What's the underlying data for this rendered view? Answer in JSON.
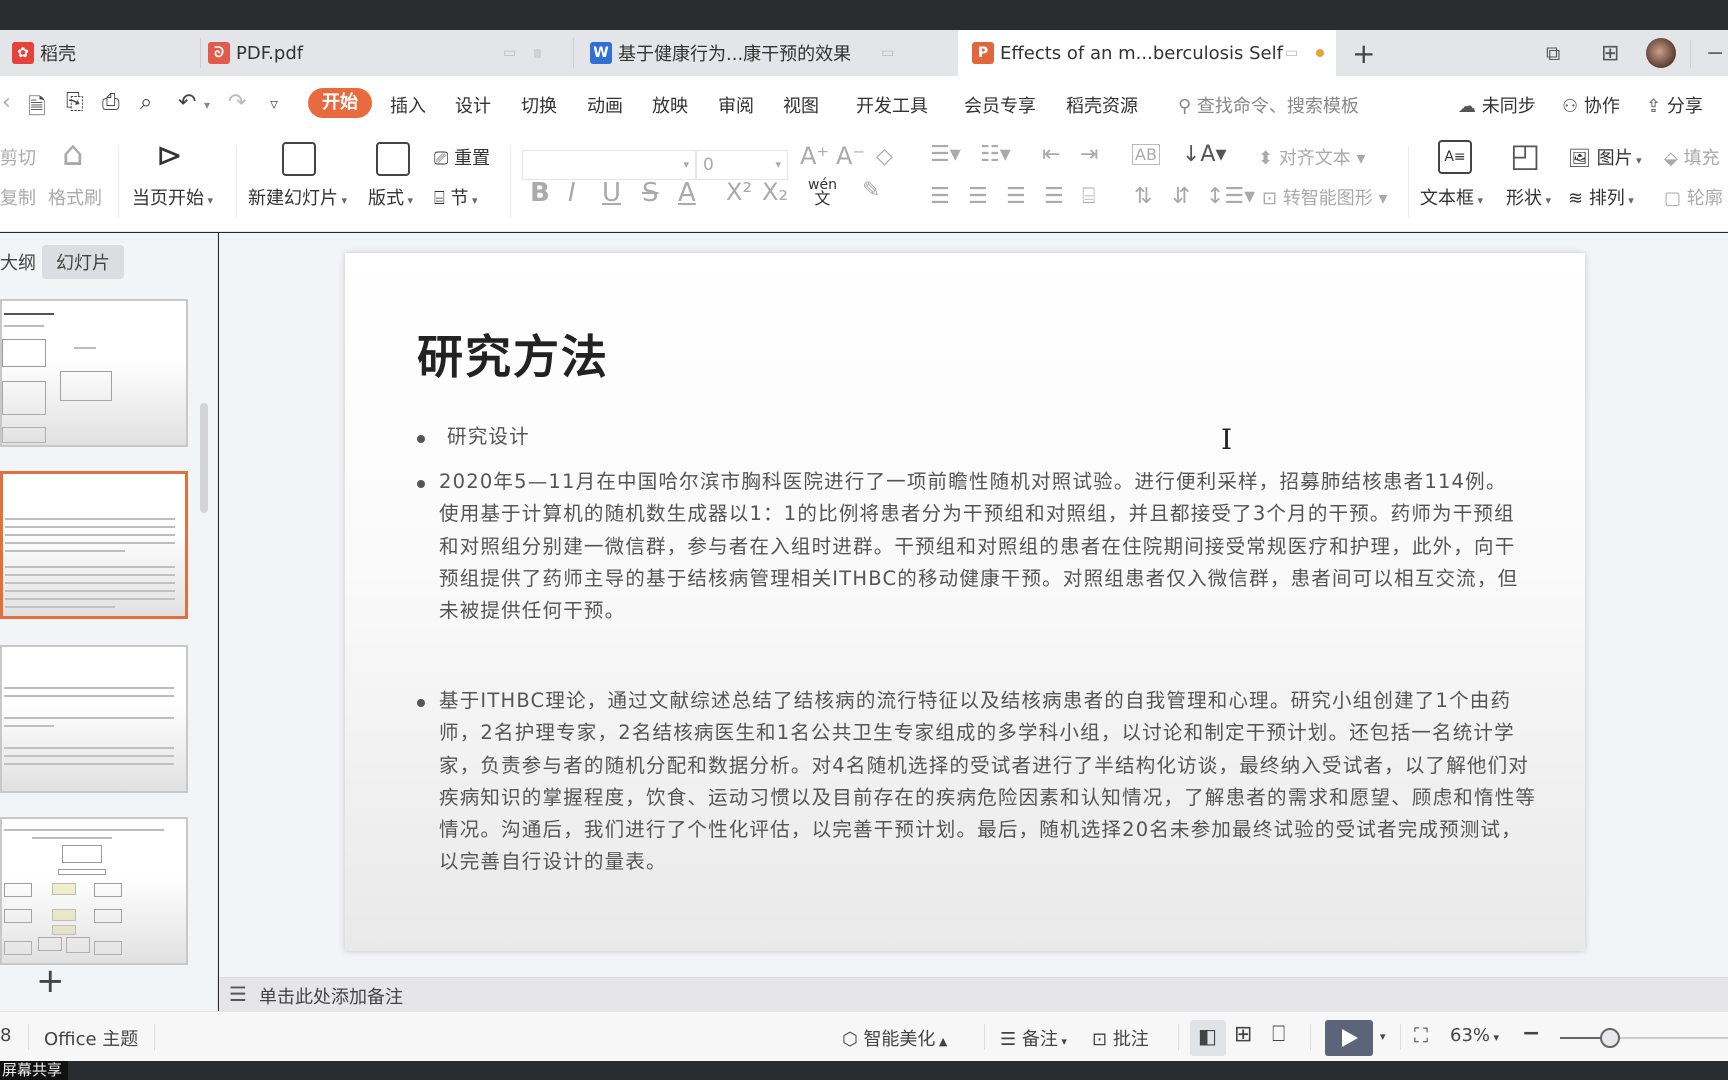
{
  "tabs": [
    {
      "label": "稻壳",
      "icon": "docer-logo-icon",
      "color": "#e8413a",
      "glyph": "⌘"
    },
    {
      "label": "PDF.pdf",
      "icon": "pdf-file-icon",
      "color": "#e25a4c",
      "glyph": "P"
    },
    {
      "label": "基于健康行为...康干预的效果",
      "icon": "word-doc-icon",
      "color": "#2f6fd6",
      "glyph": "W"
    },
    {
      "label": "Effects of an m...berculosis Self",
      "icon": "presentation-file-icon",
      "color": "#e0673d",
      "glyph": "P",
      "active": true
    }
  ],
  "new_tab": "+",
  "menu": {
    "active": "开始",
    "items": [
      "插入",
      "设计",
      "切换",
      "动画",
      "放映",
      "审阅",
      "视图",
      "开发工具",
      "会员专享",
      "稻壳资源"
    ],
    "search_placeholder": "查找命令、搜索模板",
    "right": {
      "sync": "未同步",
      "collab": "协作",
      "share": "分享"
    }
  },
  "ribbon": {
    "cut": "剪切",
    "copy": "复制",
    "format_painter": "格式刷",
    "play_from_current": "当页开始",
    "new_slide": "新建幻灯片",
    "layout": "版式",
    "reset": "重置",
    "section": "节",
    "font_name": "",
    "font_size": "0",
    "align_text": "对齐文本",
    "smart_shape": "转智能图形",
    "textbox": "文本框",
    "shape": "形状",
    "picture": "图片",
    "arrange": "排列",
    "fill": "填充",
    "outline": "轮廓",
    "phonetic": "wén"
  },
  "left_panel": {
    "tab_outline": "大纲",
    "tab_slides": "幻灯片",
    "add_slide": "+"
  },
  "slide": {
    "title": "研究方法",
    "bullets": [
      "研究设计",
      "2020年5—11月在中国哈尔滨市胸科医院进行了一项前瞻性随机对照试验。进行便利采样，招募肺结核患者114例。使用基于计算机的随机数生成器以1：1的比例将患者分为干预组和对照组，并且都接受了3个月的干预。药师为干预组和对照组分别建一微信群，参与者在入组时进群。干预组和对照组的患者在住院期间接受常规医疗和护理，此外，向干预组提供了药师主导的基于结核病管理相关ITHBC的移动健康干预。对照组患者仅入微信群，患者间可以相互交流，但未被提供任何干预。",
      "基于ITHBC理论，通过文献综述总结了结核病的流行特征以及结核病患者的自我管理和心理。研究小组创建了1个由药师，2名护理专家，2名结核病医生和1名公共卫生专家组成的多学科小组，以讨论和制定干预计划。还包括一名统计学家，负责参与者的随机分配和数据分析。对4名随机选择的受试者进行了半结构化访谈，最终纳入受试者，以了解他们对疾病知识的掌握程度，饮食、运动习惯以及目前存在的疾病危险因素和认知情况，了解患者的需求和愿望、顾虑和惰性等情况。沟通后，我们进行了个性化评估，以完善干预计划。最后，随机选择20名未参加最终试验的受试者完成预测试，以完善自行设计的量表。"
    ]
  },
  "notes_placeholder": "单击此处添加备注",
  "status": {
    "slide_num": "8",
    "theme": "Office 主题",
    "smart_beautify": "智能美化",
    "notes": "备注",
    "comments": "批注",
    "zoom": "63%",
    "zoom_fraction": 0.3
  },
  "taskbar_label": "屏幕共享"
}
